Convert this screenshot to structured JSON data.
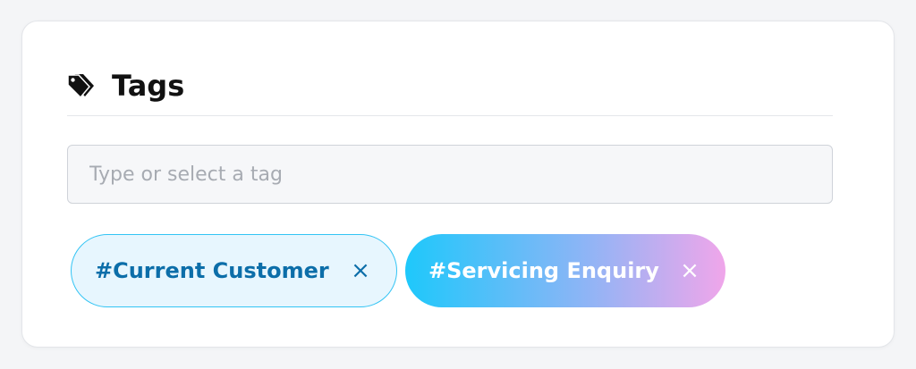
{
  "panel": {
    "title": "Tags",
    "header_icon": "tags-icon"
  },
  "input": {
    "placeholder": "Type or select a tag",
    "value": ""
  },
  "chips": [
    {
      "label": "#Current Customer",
      "remove_icon": "close-icon",
      "style": "outlined-light-blue"
    },
    {
      "label": "#Servicing Enquiry",
      "remove_icon": "close-icon",
      "style": "gradient-blue-pink"
    }
  ],
  "colors": {
    "chip_outline": "#33c4f4",
    "chip_text_blue": "#0c6ea9",
    "gradient_start": "#1ec8fb",
    "gradient_end": "#f0a6ea"
  },
  "remove_glyph": "×"
}
